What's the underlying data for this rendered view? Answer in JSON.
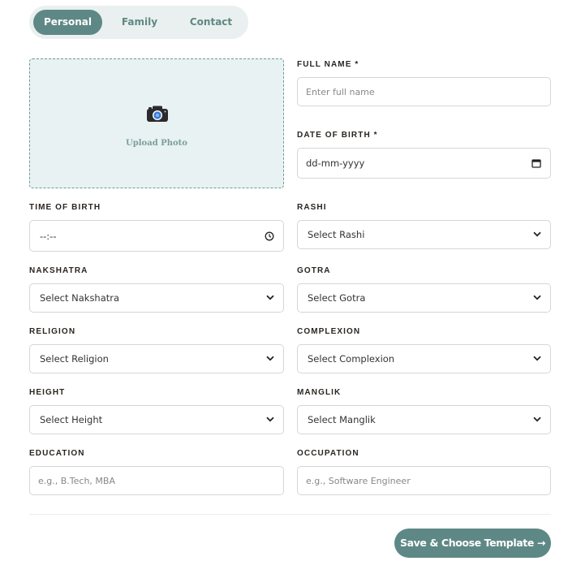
{
  "tabs": [
    {
      "label": "Personal",
      "active": true
    },
    {
      "label": "Family",
      "active": false
    },
    {
      "label": "Contact",
      "active": false
    }
  ],
  "photo": {
    "label": "Upload Photo",
    "icon": "camera-icon"
  },
  "fields": {
    "full_name": {
      "label": "FULL NAME *",
      "placeholder": "Enter full name"
    },
    "dob": {
      "label": "DATE OF BIRTH *",
      "value": "dd-mm-yyyy",
      "icon": "calendar-icon"
    },
    "tob": {
      "label": "TIME OF BIRTH",
      "value": "--:--",
      "icon": "clock-icon"
    },
    "rashi": {
      "label": "RASHI",
      "value": "Select Rashi"
    },
    "nakshatra": {
      "label": "NAKSHATRA",
      "value": "Select Nakshatra"
    },
    "gotra": {
      "label": "GOTRA",
      "value": "Select Gotra"
    },
    "religion": {
      "label": "RELIGION",
      "value": "Select Religion"
    },
    "complexion": {
      "label": "COMPLEXION",
      "value": "Select Complexion"
    },
    "height": {
      "label": "HEIGHT",
      "value": "Select Height"
    },
    "manglik": {
      "label": "MANGLIK",
      "value": "Select Manglik"
    },
    "education": {
      "label": "EDUCATION",
      "placeholder": "e.g., B.Tech, MBA"
    },
    "occupation": {
      "label": "OCCUPATION",
      "placeholder": "e.g., Software Engineer"
    }
  },
  "actions": {
    "save_label": "Save & Choose Template →"
  },
  "colors": {
    "accent": "#5e8885",
    "tab_bg": "#e9f0ef",
    "upload_bg": "#e9f2f2"
  }
}
